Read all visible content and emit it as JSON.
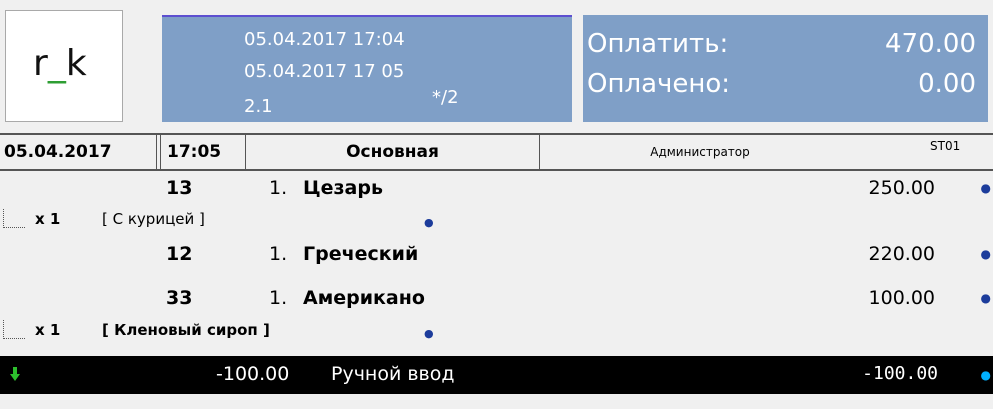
{
  "logo": {
    "text_before": "r",
    "underscore": "_",
    "text_after": "k",
    "accent_color": "#2e9e33"
  },
  "order_info": {
    "line1": "05.04.2017 17:04",
    "line2": "05.04.2017 17 05",
    "line3": "2.1",
    "guests": "*/2"
  },
  "payment": {
    "to_pay_label": "Оплатить:",
    "to_pay_value": "470.00",
    "paid_label": "Оплачено:",
    "paid_value": "0.00"
  },
  "status_bar": {
    "date": "05.04.2017",
    "time": "17:05",
    "menu": "Основная",
    "user": "Администратор",
    "station": "ST01"
  },
  "items": [
    {
      "code": "13",
      "qty": "1.",
      "name": "Цезарь",
      "price": "250.00"
    },
    {
      "code": "12",
      "qty": "1.",
      "name": "Греческий",
      "price": "220.00"
    },
    {
      "code": "33",
      "qty": "1.",
      "name": "Американо",
      "price": "100.00"
    }
  ],
  "modifiers": [
    {
      "qty": "x 1",
      "name": "[ С курицей ]"
    },
    {
      "qty": "x 1",
      "name": "[ Кленовый сироп ]"
    }
  ],
  "discount": {
    "amount": "-100.00",
    "name": "Ручной ввод",
    "total": "-100.00",
    "icon": "green-down-arrow-icon"
  },
  "colors": {
    "panel_blue": "#7f9fc7",
    "selection_black": "#000000",
    "arrow_green": "#2dbf2d"
  }
}
